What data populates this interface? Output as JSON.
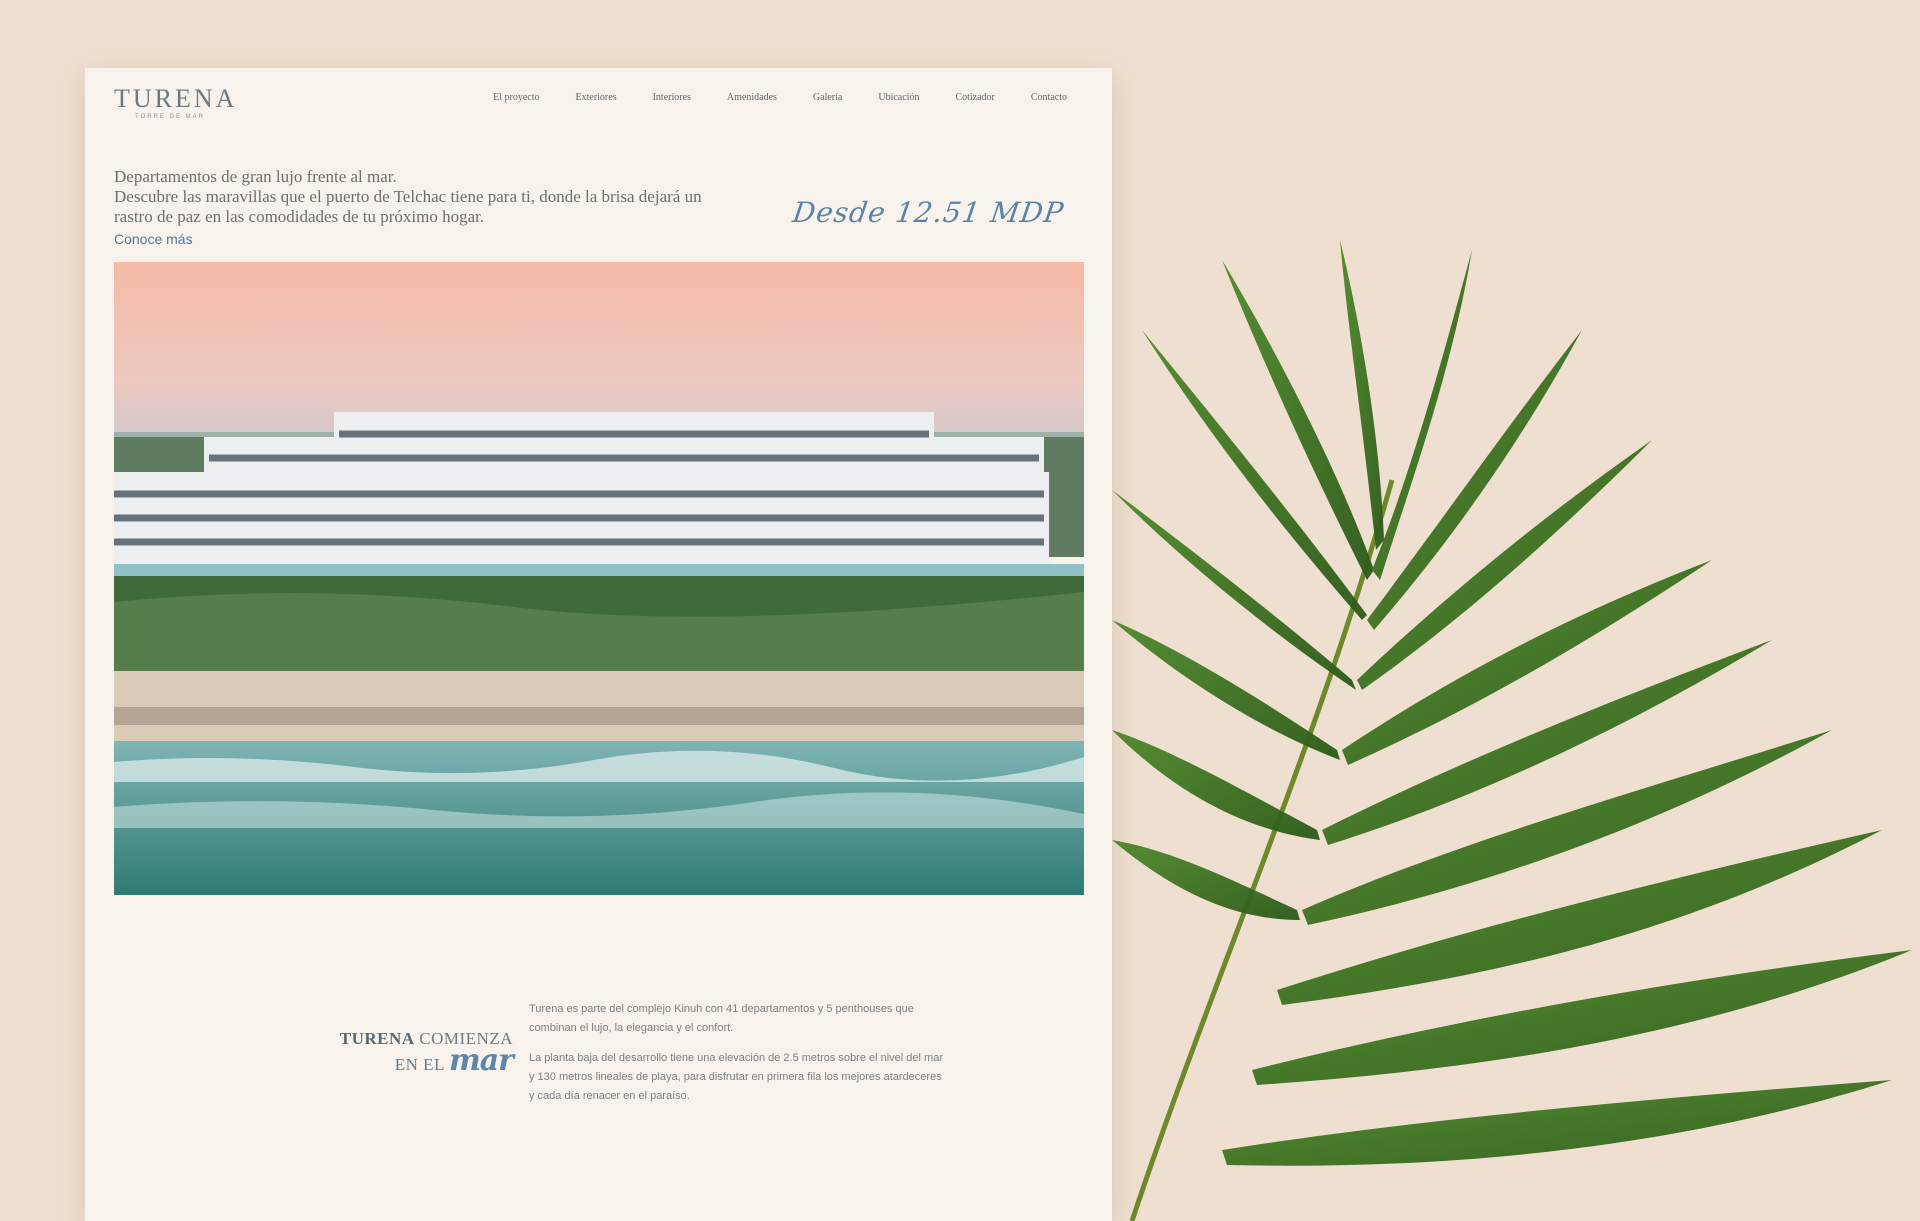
{
  "brand": {
    "name": "TURENA",
    "tagline": "TORRE DE MAR"
  },
  "nav": {
    "items": [
      "El proyecto",
      "Exteriores",
      "Interiores",
      "Amenidades",
      "Galería",
      "Ubicación",
      "Cotizador",
      "Contacto"
    ]
  },
  "intro": {
    "line1": "Departamentos de gran lujo frente al mar.",
    "line2": "Descubre las maravillas que el puerto de Telchac tiene para ti, donde la brisa dejará un rastro de paz en las comodidades de tu próximo hogar.",
    "link": "Conoce más"
  },
  "price": "Desde 12.51 MDP",
  "section": {
    "title_strong": "TURENA",
    "title_rest": "COMIENZA",
    "title_line2": "EN EL",
    "title_script": "mar",
    "paragraph1": "Turena es parte del complejo Kinuh con 41 departamentos y 5 penthouses que combinan el lujo, la elegancia y el confort.",
    "paragraph2": "La planta baja del desarrollo tiene una elevación de 2.5 metros sobre el nivel del mar y 130 metros lineales de playa, para disfrutar en primera fila los mejores atardeceres y cada día renacer en el paraíso."
  },
  "colors": {
    "background": "#efdfd0",
    "page": "#f8f2ec",
    "accent_blue": "#5c82a8",
    "text_gray": "#6b6f70"
  }
}
